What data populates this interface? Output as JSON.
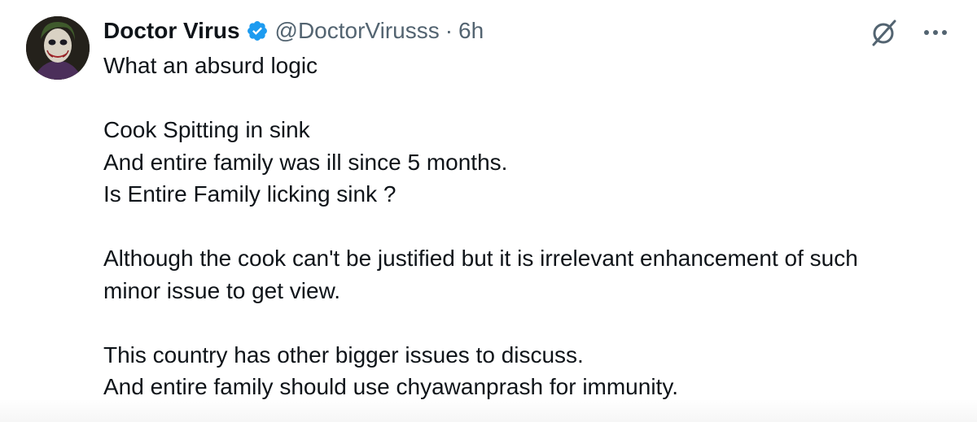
{
  "author": {
    "display_name": "Doctor Virus",
    "handle": "@DoctorVirusss",
    "separator": "·",
    "time": "6h",
    "verified": true
  },
  "icons": {
    "avatar": "joker-avatar",
    "verified": "verified-badge-icon",
    "grok": "grok-icon",
    "more": "more-icon"
  },
  "tweet": {
    "lines": [
      "What an absurd logic",
      "",
      "Cook Spitting in sink",
      "And entire family was ill since 5 months.",
      "Is Entire Family licking sink ?",
      "",
      "Although the cook can't be justified but it is irrelevant enhancement of such",
      "minor issue to get view.",
      "",
      "This country has other bigger issues to discuss.",
      "And entire family should use chyawanprash for immunity."
    ]
  },
  "colors": {
    "text": "#0f1419",
    "secondary": "#536471",
    "verified_blue": "#1d9bf0",
    "background": "#ffffff"
  }
}
